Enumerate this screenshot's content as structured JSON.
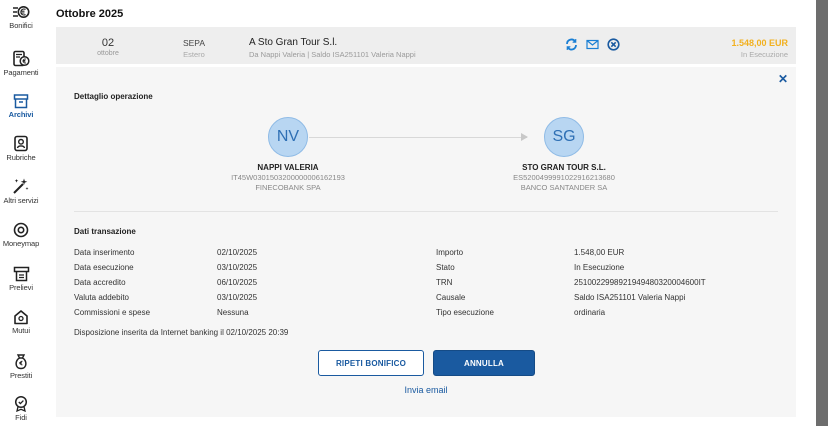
{
  "sidebar": {
    "items": [
      {
        "label": "Bonifici",
        "icon": "euro-transfer-icon",
        "active": false
      },
      {
        "label": "Pagamenti",
        "icon": "payments-icon",
        "active": false
      },
      {
        "label": "Archivi",
        "icon": "archive-icon",
        "active": true
      },
      {
        "label": "Rubriche",
        "icon": "contacts-icon",
        "active": false
      },
      {
        "label": "Altri servizi",
        "icon": "magic-wand-icon",
        "active": false
      },
      {
        "label": "Moneymap",
        "icon": "moneymap-icon",
        "active": false
      },
      {
        "label": "Prelievi",
        "icon": "atm-icon",
        "active": false
      },
      {
        "label": "Mutui",
        "icon": "house-icon",
        "active": false
      },
      {
        "label": "Prestiti",
        "icon": "money-bag-icon",
        "active": false
      },
      {
        "label": "Fidi",
        "icon": "badge-icon",
        "active": false
      }
    ]
  },
  "month_title": "Ottobre 2025",
  "transaction": {
    "day": "02",
    "month": "ottobre",
    "type": "SEPA",
    "type_sub": "Estero",
    "name": "A Sto Gran Tour S.l.",
    "description": "Da Nappi Valeria | Saldo ISA251101 Valeria Nappi",
    "amount": "1.548,00 EUR",
    "status": "In Esecuzione",
    "icons": [
      "repeat-icon",
      "email-icon",
      "cancel-icon"
    ]
  },
  "detail": {
    "title": "Dettaglio operazione",
    "sender": {
      "initials": "NV",
      "name": "NAPPI VALERIA",
      "iban": "IT45W0301503200000006162193",
      "bank": "FINECOBANK SPA"
    },
    "receiver": {
      "initials": "SG",
      "name": "STO GRAN TOUR S.L.",
      "iban": "ES5200499991022916213680",
      "bank": "BANCO SANTANDER SA"
    },
    "section_title": "Dati transazione",
    "left_fields": [
      {
        "label": "Data inserimento",
        "value": "02/10/2025"
      },
      {
        "label": "Data esecuzione",
        "value": "03/10/2025"
      },
      {
        "label": "Data accredito",
        "value": "06/10/2025"
      },
      {
        "label": "Valuta addebito",
        "value": "03/10/2025"
      },
      {
        "label": "Commissioni e spese",
        "value": "Nessuna"
      }
    ],
    "right_fields": [
      {
        "label": "Importo",
        "value": "1.548,00 EUR"
      },
      {
        "label": "Stato",
        "value": "In Esecuzione"
      },
      {
        "label": "TRN",
        "value": "2510022998921949480320004600IT"
      },
      {
        "label": "Causale",
        "value": "Saldo ISA251101 Valeria Nappi"
      },
      {
        "label": "Tipo esecuzione",
        "value": "ordinaria"
      }
    ],
    "note": "Disposizione inserita da Internet banking il 02/10/2025 20:39",
    "repeat_button": "RIPETI BONIFICO",
    "cancel_button": "ANNULLA",
    "email_link": "Invia email"
  },
  "colors": {
    "accent": "#1a5aa0",
    "amount": "#f2b01e",
    "avatar_bg": "#b8d6f2"
  }
}
